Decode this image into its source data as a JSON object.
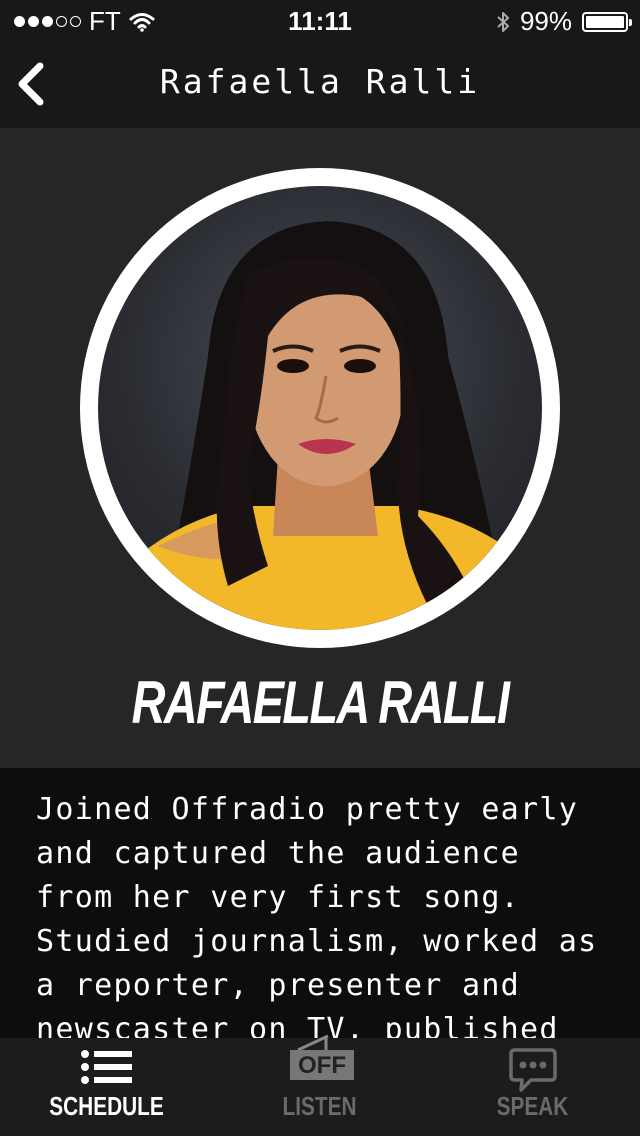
{
  "status_bar": {
    "carrier": "FT",
    "time": "11:11",
    "battery": "99%"
  },
  "nav": {
    "title": "Rafaella Ralli"
  },
  "profile": {
    "name": "RAFAELLA RALLI",
    "bio": "Joined Offradio pretty early\nand captured the audience\nfrom her very first song.\nStudied journalism, worked as\na reporter, presenter and\nnewscaster on TV, published"
  },
  "tabs": [
    {
      "label": "SCHEDULE",
      "icon": "list-icon",
      "active": true
    },
    {
      "label": "LISTEN",
      "icon": "radio-off-icon",
      "badge": "OFF",
      "active": false
    },
    {
      "label": "SPEAK",
      "icon": "chat-bubble-icon",
      "active": false
    }
  ],
  "colors": {
    "background": "#262626",
    "bar": "#181818",
    "bio_background": "#0d0d0d",
    "active_tab": "#ffffff",
    "inactive_tab": "#6a6a6a",
    "shirt": "#f2b82a"
  }
}
